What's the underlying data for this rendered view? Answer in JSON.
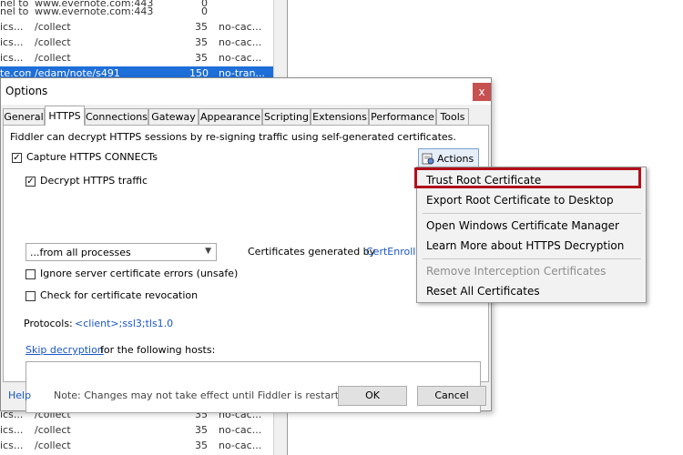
{
  "background_sessions": {
    "top_rows": [
      {
        "c1": "nel to",
        "c2": "www.evernote.com:443",
        "c3": "0",
        "c4": ""
      },
      {
        "c1": "ics...",
        "c2": "/collect",
        "c3": "35",
        "c4": "no-cac..."
      },
      {
        "c1": "ics...",
        "c2": "/collect",
        "c3": "35",
        "c4": "no-cac..."
      },
      {
        "c1": "ics...",
        "c2": "/collect",
        "c3": "35",
        "c4": "no-cac..."
      },
      {
        "c1": "te.com",
        "c2": "/edam/note/s491",
        "c3": "150",
        "c4": "no-tran..."
      }
    ],
    "bottom_rows": [
      {
        "c1": "ics...",
        "c2": "/collect",
        "c3": "35",
        "c4": "no-cac..."
      },
      {
        "c1": "ics...",
        "c2": "/collect",
        "c3": "35",
        "c4": "no-cac..."
      },
      {
        "c1": "ics...",
        "c2": "/collect",
        "c3": "35",
        "c4": "no-cac..."
      }
    ],
    "accent_color": "#1e6fd9"
  },
  "dialog": {
    "title": "Options",
    "close_label": "x",
    "tabs": [
      "General",
      "HTTPS",
      "Connections",
      "Gateway",
      "Appearance",
      "Scripting",
      "Extensions",
      "Performance",
      "Tools"
    ],
    "active_tab": "HTTPS",
    "description": "Fiddler can decrypt HTTPS sessions by re-signing traffic using self-generated certificates.",
    "capture_https": {
      "label": "Capture HTTPS CONNECTs",
      "checked": true
    },
    "decrypt_https": {
      "label": "Decrypt HTTPS traffic",
      "checked": true
    },
    "process_filter": "...from all processes",
    "certs_generated_by": "Certificates generated by",
    "cert_engine_link": "CertEnroll e",
    "ignore_errors": {
      "label": "Ignore server certificate errors (unsafe)",
      "checked": false
    },
    "check_revocation": {
      "label": "Check for certificate revocation",
      "checked": false
    },
    "protocols_label": "Protocols:",
    "protocols_value": "<client>;ssl3;tls1.0",
    "skip_decryption_link": "Skip decryption",
    "skip_decryption_text": "for the following hosts:",
    "hosts_value": "",
    "actions_button": "Actions",
    "help_link": "Help",
    "note": "Note: Changes may not take effect until Fiddler is restarted.",
    "ok_button": "OK",
    "cancel_button": "Cancel"
  },
  "actions_menu": {
    "items": [
      {
        "label": "Trust Root Certificate",
        "enabled": true,
        "highlighted": true
      },
      {
        "label": "Export Root Certificate to Desktop",
        "enabled": true
      },
      {
        "label": "Open Windows Certificate Manager",
        "enabled": true
      },
      {
        "label": "Learn More about HTTPS Decryption",
        "enabled": true
      },
      {
        "label": "Remove Interception Certificates",
        "enabled": false
      },
      {
        "label": "Reset All Certificates",
        "enabled": true
      }
    ],
    "highlight_color": "#b0111b"
  }
}
